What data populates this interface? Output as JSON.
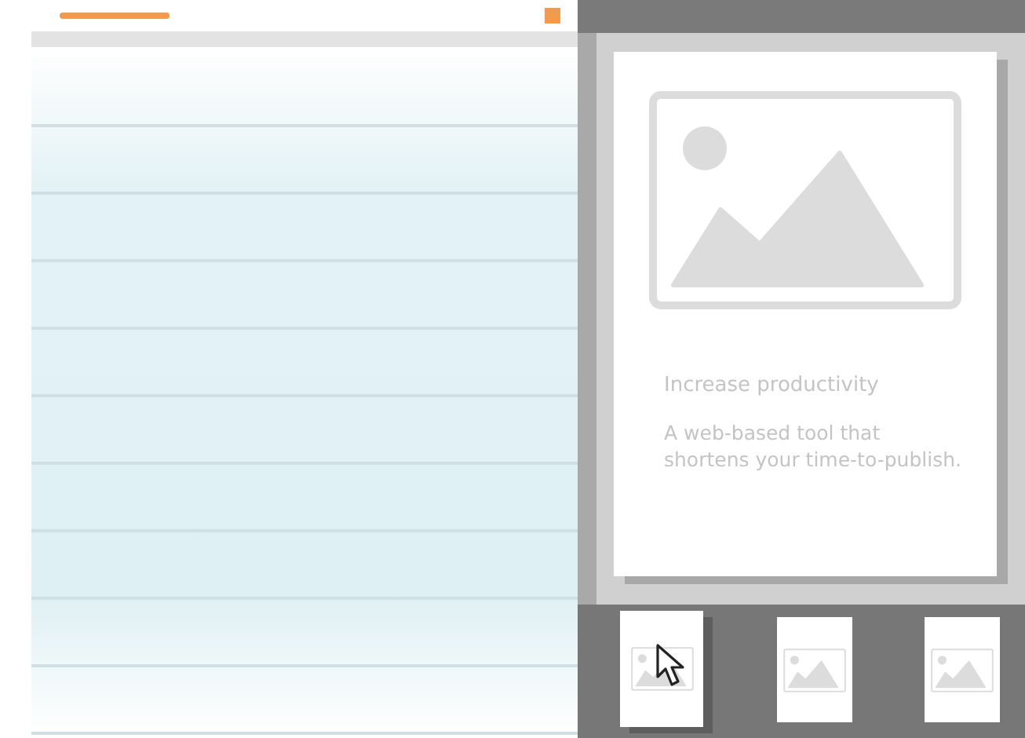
{
  "slide": {
    "heading": "Increase productivity",
    "body_lines": [
      "A web-based tool that",
      "shortens your time-to-publish."
    ]
  },
  "thumbnails": [
    {
      "selected": true
    },
    {
      "selected": false
    },
    {
      "selected": false
    }
  ]
}
